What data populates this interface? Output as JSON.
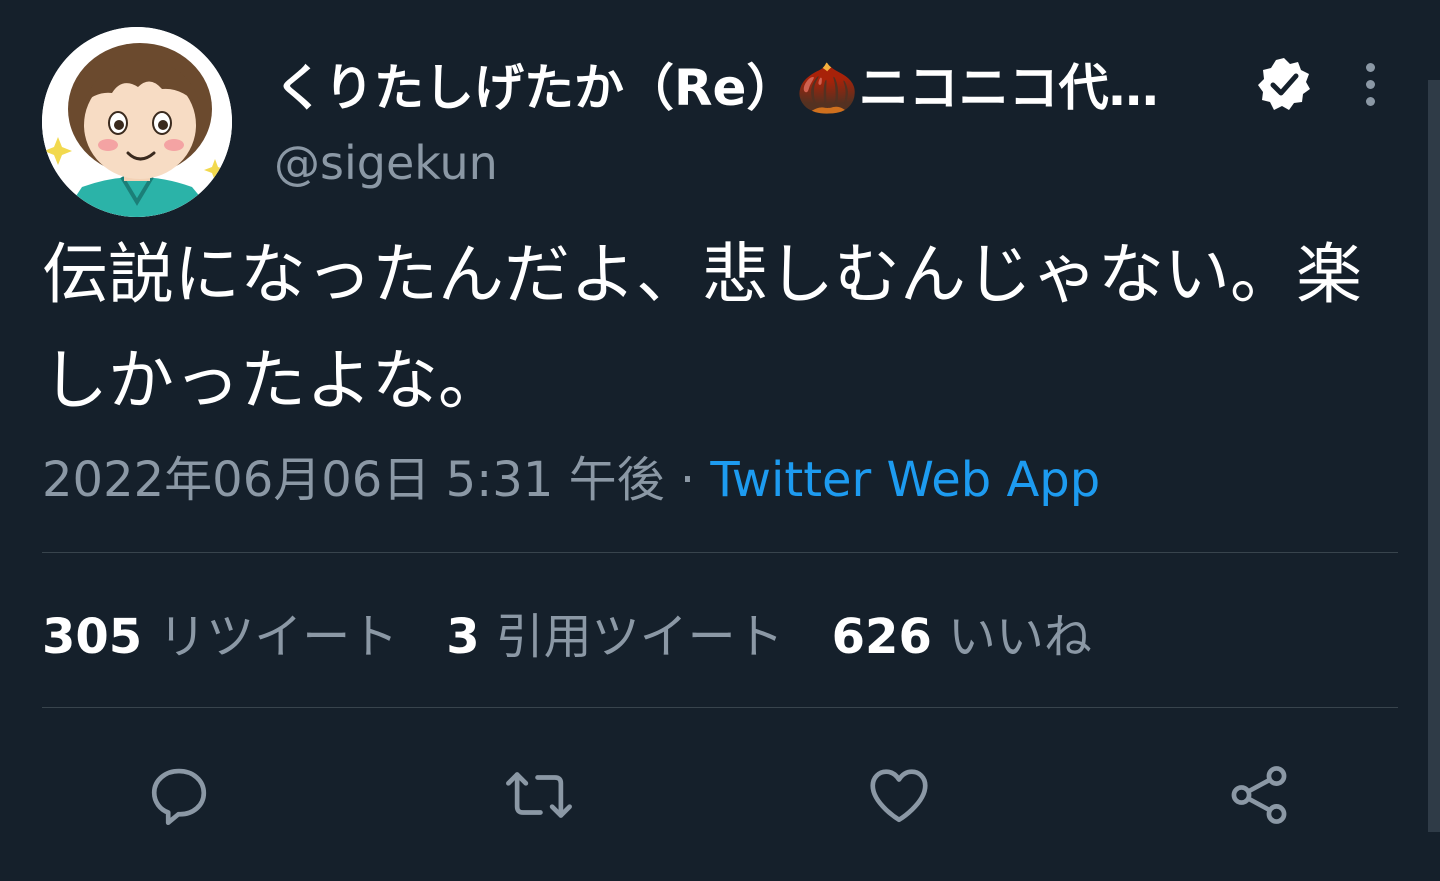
{
  "author": {
    "display_name": "くりたしげたか（Re）🌰ニコニコ代…",
    "handle": "@sigekun",
    "verified_icon": "verified-badge-icon",
    "avatar_icon": "avatar-illustration"
  },
  "tweet": {
    "text": "伝説になったんだよ、悲しむんじゃない。楽しかったよな。",
    "timestamp": "2022年06月06日 5:31 午後",
    "separator": " · ",
    "source": "Twitter Web App"
  },
  "stats": {
    "retweets": {
      "count": "305",
      "label": "リツイート"
    },
    "quotes": {
      "count": "3",
      "label": "引用ツイート"
    },
    "likes": {
      "count": "626",
      "label": "いいね"
    }
  },
  "actions": {
    "reply_icon": "reply-icon",
    "retweet_icon": "retweet-icon",
    "like_icon": "heart-icon",
    "share_icon": "share-icon"
  },
  "colors": {
    "background": "#15202b",
    "text_primary": "#ffffff",
    "text_secondary": "#8b98a5",
    "accent": "#1d9bf0",
    "divider": "#38444d"
  }
}
